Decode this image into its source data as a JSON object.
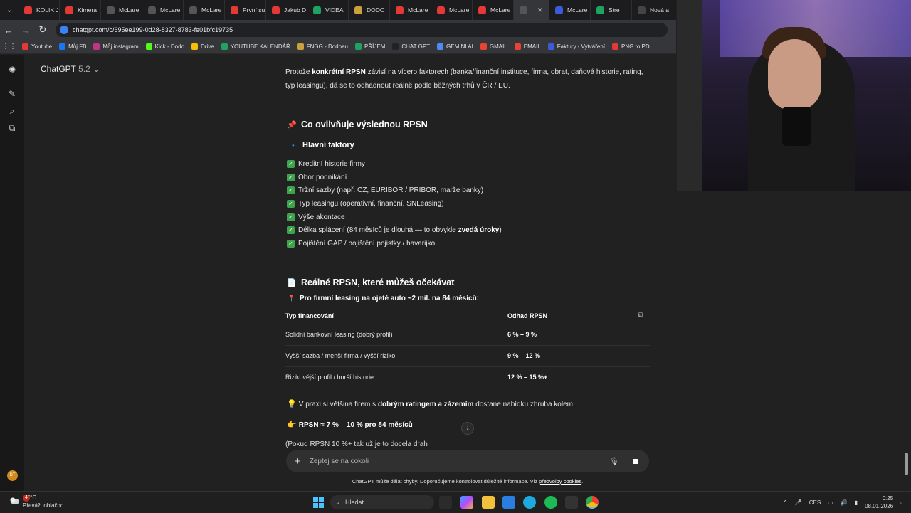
{
  "tabs": [
    {
      "label": "KOLIK J",
      "color": "#e53935"
    },
    {
      "label": "Kimera",
      "color": "#e53935"
    },
    {
      "label": "McLare",
      "color": "#555555"
    },
    {
      "label": "McLare",
      "color": "#555555"
    },
    {
      "label": "McLare",
      "color": "#555555"
    },
    {
      "label": "První su",
      "color": "#e53935"
    },
    {
      "label": "Jakub D",
      "color": "#e53935"
    },
    {
      "label": "VIDEA",
      "color": "#1ea362"
    },
    {
      "label": "DODO",
      "color": "#caa23c"
    },
    {
      "label": "McLare",
      "color": "#e53935"
    },
    {
      "label": "McLare",
      "color": "#e53935"
    },
    {
      "label": "McLare",
      "color": "#e53935"
    },
    {
      "label": "",
      "color": "#555555"
    },
    {
      "label": "McLare",
      "color": "#3b5bdb"
    },
    {
      "label": "Stre",
      "color": "#1ea362"
    },
    {
      "label": "Nová a",
      "color": "#444444"
    }
  ],
  "address": {
    "url": "chatgpt.com/c/695ee199-0d28-8327-8783-fe01bfc19735"
  },
  "bookmarks": [
    {
      "label": "Youtube",
      "color": "#e53935"
    },
    {
      "label": "Můj FB",
      "color": "#1877f2"
    },
    {
      "label": "Můj instagram",
      "color": "#c13584"
    },
    {
      "label": "Kick - Dodo",
      "color": "#53fc18"
    },
    {
      "label": "Drive",
      "color": "#fbbc04"
    },
    {
      "label": "YOUTUBE KALENDÁŘ",
      "color": "#1ea362"
    },
    {
      "label": "FNGG - Dodoeu",
      "color": "#caa23c"
    },
    {
      "label": "PŘÍJEM",
      "color": "#1ea362"
    },
    {
      "label": "CHAT GPT",
      "color": "#222222"
    },
    {
      "label": "GEMINI AI",
      "color": "#4c8bf5"
    },
    {
      "label": "GMAIL",
      "color": "#ea4335"
    },
    {
      "label": "EMAIL",
      "color": "#ea4335"
    },
    {
      "label": "Faktury - Vytváření",
      "color": "#3b5bdb"
    },
    {
      "label": "PNG to PD",
      "color": "#e53935"
    }
  ],
  "app": {
    "model_label": "ChatGPT",
    "model_version": "5.2",
    "avatar_initials": "DT"
  },
  "message": {
    "intro_pre": "Protože ",
    "intro_bold": "konkrétní RPSN",
    "intro_post": " závisí na vícero faktorech (banka/finanční instituce, firma, obrat, daňová historie, rating, typ leasingu), dá se to odhadnout reálně podle běžných trhů v ČR / EU.",
    "section1_emoji": "📌",
    "section1_title": "Co ovlivňuje výslednou RPSN",
    "subsection_emoji": "🔹",
    "subsection_title": "Hlavní faktory",
    "factors": [
      {
        "text": "Kreditní historie firmy",
        "bold": ""
      },
      {
        "text": "Obor podnikání",
        "bold": ""
      },
      {
        "text": "Tržní sazby (např. CZ, EURIBOR / PRIBOR, marže banky)",
        "bold": ""
      },
      {
        "text": "Typ leasingu (operativní, finanční, SNLeasing)",
        "bold": ""
      },
      {
        "text": "Výše akontace",
        "bold": ""
      },
      {
        "text": "Délka splácení (84 měsíců je dlouhá — to obvykle ",
        "bold": "zvedá úroky",
        "after": ")"
      },
      {
        "text": "Pojištění GAP / pojištění pojistky / havarijko",
        "bold": ""
      }
    ],
    "section2_emoji": "📄",
    "section2_title": "Reálné RPSN, které můžeš očekávat",
    "pin_emoji": "📍",
    "table_caption": "Pro firmní leasing na ojeté auto ~2 mil. na 84 měsíců:",
    "table_headers": [
      "Typ financování",
      "Odhad RPSN"
    ],
    "table_rows": [
      [
        "Solidní bankovní leasing (dobrý profil)",
        "6 % – 9 %"
      ],
      [
        "Vyšší sazba / menší firma / vyšší riziko",
        "9 % – 12 %"
      ],
      [
        "Rizikovější profil / horší historie",
        "12 % – 15 %+"
      ]
    ],
    "tip_emoji": "💡",
    "tip_pre": "V praxi si většina firem s ",
    "tip_bold": "dobrým ratingem a zázemím",
    "tip_post": " dostane nabídku zhruba kolem:",
    "result_emoji": "👉",
    "result_text": "RPSN ≈ 7 % – 10 % pro 84 měsíců",
    "cut_text": "(Pokud RPSN 10 %+ tak už je to docela drah"
  },
  "composer": {
    "placeholder": "Zeptej se na cokoli"
  },
  "disclaimer": {
    "text": "ChatGPT může dělat chyby. Doporučujeme kontrolovat důležité informace. Viz ",
    "link": "předvolby cookies",
    "end": "."
  },
  "taskbar": {
    "weather_temp": "-7°C",
    "weather_desc": "Převáž. oblačno",
    "notif_count": "4",
    "search_label": "Hledat",
    "lang": "CES",
    "time": "0:25",
    "date": "08.01.2026"
  }
}
